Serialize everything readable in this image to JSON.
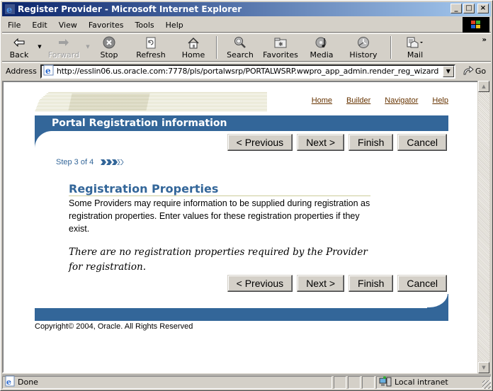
{
  "window": {
    "title": "Register Provider - Microsoft Internet Explorer",
    "controls": {
      "minimize": "_",
      "maximize": "□",
      "close": "×"
    }
  },
  "menubar": {
    "items": [
      "File",
      "Edit",
      "View",
      "Favorites",
      "Tools",
      "Help"
    ]
  },
  "toolbar": {
    "buttons": [
      {
        "label": "Back",
        "icon": "back-arrow-icon",
        "enabled": true
      },
      {
        "label": "Forward",
        "icon": "forward-arrow-icon",
        "enabled": false
      },
      {
        "label": "Stop",
        "icon": "stop-icon",
        "enabled": true
      },
      {
        "label": "Refresh",
        "icon": "refresh-icon",
        "enabled": true
      },
      {
        "label": "Home",
        "icon": "home-icon",
        "enabled": true
      },
      {
        "label": "Search",
        "icon": "search-icon",
        "enabled": true
      },
      {
        "label": "Favorites",
        "icon": "favorites-icon",
        "enabled": true
      },
      {
        "label": "Media",
        "icon": "media-icon",
        "enabled": true
      },
      {
        "label": "History",
        "icon": "history-icon",
        "enabled": true
      },
      {
        "label": "Mail",
        "icon": "mail-icon",
        "enabled": true
      }
    ],
    "overflow": "»"
  },
  "addressbar": {
    "label": "Address",
    "url": "http://esslin06.us.oracle.com:7778/pls/portalwsrp/PORTALWSRP.wwpro_app_admin.render_reg_wizard",
    "go_label": "Go"
  },
  "page": {
    "toplinks": [
      "Home",
      "Builder",
      "Navigator",
      "Help"
    ],
    "header_title": "Portal Registration information",
    "buttons": {
      "previous": "< Previous",
      "next": "Next >",
      "finish": "Finish",
      "cancel": "Cancel"
    },
    "step": {
      "text": "Step 3 of 4",
      "current": 3,
      "total": 4
    },
    "section": {
      "title": "Registration Properties",
      "description": "Some Providers may require information to be supplied during registration as registration properties. Enter values for these registration properties if they exist.",
      "note": "There are no registration properties required by the Provider for registration."
    },
    "copyright": "Copyright© 2004, Oracle. All Rights Reserved"
  },
  "statusbar": {
    "status": "Done",
    "zone": "Local intranet"
  },
  "colors": {
    "brand_blue": "#336699",
    "link_brown": "#663300",
    "title_gradient_start": "#0a246a",
    "title_gradient_end": "#a6caf0"
  }
}
